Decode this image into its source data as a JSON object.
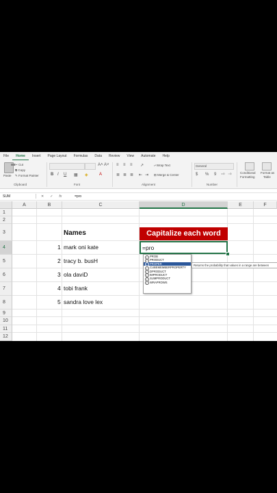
{
  "ribbon": {
    "tabs": [
      "File",
      "Home",
      "Insert",
      "Page Layout",
      "Formulas",
      "Data",
      "Review",
      "View",
      "Automate",
      "Help"
    ],
    "active_tab": "Home",
    "clipboard": {
      "paste": "Paste",
      "cut": "Cut",
      "copy": "Copy",
      "format_painter": "Format Painter",
      "label": "Clipboard"
    },
    "font_label": "Font",
    "alignment": {
      "wrap": "Wrap Text",
      "merge": "Merge & Center",
      "label": "Alignment"
    },
    "number": {
      "format": "General",
      "label": "Number"
    },
    "styles": {
      "conditional": "Conditional",
      "formatting": "Formatting",
      "format_as": "Format as",
      "table": "Table"
    }
  },
  "formula_bar": {
    "name_box": "SUM",
    "cancel": "✕",
    "enter": "✓",
    "fx": "fx",
    "content": "=pro"
  },
  "columns": [
    "A",
    "B",
    "C",
    "D",
    "E",
    "F"
  ],
  "rows": [
    "1",
    "2",
    "3",
    "4",
    "5",
    "6",
    "7",
    "8",
    "9",
    "10",
    "11",
    "12"
  ],
  "table": {
    "names_header": "Names",
    "cap_header": "Capitalize each word",
    "entries": [
      {
        "num": "1",
        "name": "mark oni kate"
      },
      {
        "num": "2",
        "name": "tracy b. busH"
      },
      {
        "num": "3",
        "name": "ola daviD"
      },
      {
        "num": "4",
        "name": "tobi frank"
      },
      {
        "num": "5",
        "name": "sandra love lex"
      }
    ]
  },
  "active_cell": {
    "ref": "D4",
    "value": "=pro"
  },
  "autocomplete": {
    "items": [
      "PROB",
      "PRODUCT",
      "PROPER",
      "CUBEMEMBERPROPERTY",
      "DPRODUCT",
      "IMPRODUCT",
      "SUMPRODUCT",
      "WRAPROWS"
    ],
    "selected": "PROPER",
    "tooltip": "Returns the probability that values in a range are between"
  },
  "colors": {
    "accent": "#217346",
    "header_fill": "#c00000",
    "selection": "#2b579a"
  }
}
